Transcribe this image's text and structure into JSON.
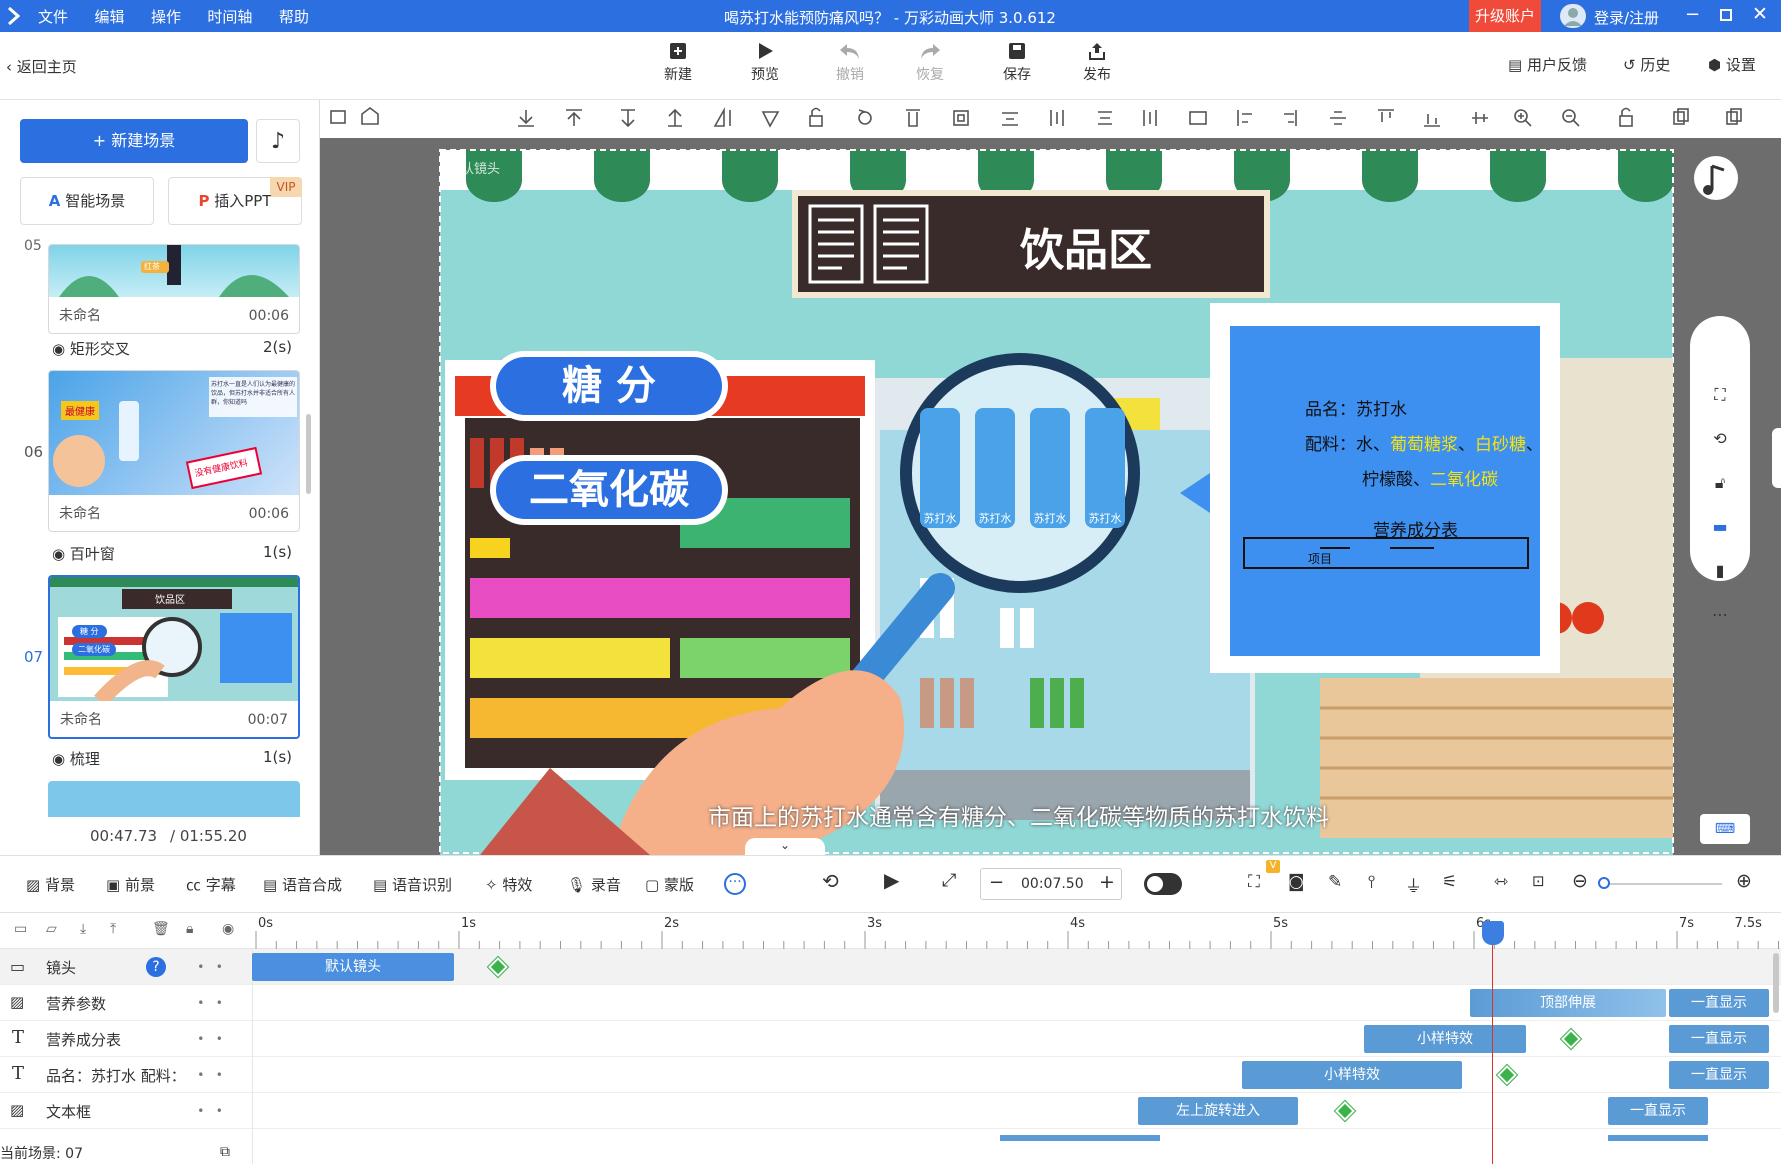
{
  "titlebar": {
    "menu": [
      "文件",
      "编辑",
      "操作",
      "时间轴",
      "帮助"
    ],
    "title": "喝苏打水能预防痛风吗？ - 万彩动画大师 3.0.612",
    "upgrade": "升级账户",
    "login": "登录/注册"
  },
  "toolbar": {
    "back": "返回主页",
    "buttons": [
      {
        "label": "新建",
        "icon": "plus-box-icon"
      },
      {
        "label": "预览",
        "icon": "play-icon"
      },
      {
        "label": "撤销",
        "icon": "undo-icon"
      },
      {
        "label": "恢复",
        "icon": "redo-icon"
      },
      {
        "label": "保存",
        "icon": "save-icon"
      },
      {
        "label": "发布",
        "icon": "publish-icon"
      }
    ],
    "right": [
      "用户反馈",
      "历史",
      "设置"
    ]
  },
  "left_panel": {
    "new_scene": "+ 新建场景",
    "smart_scene": "智能场景",
    "insert_ppt": "插入PPT",
    "vip": "VIP",
    "scenes": [
      {
        "num": "05",
        "name": "未命名",
        "time": "00:06"
      },
      {
        "num": "06",
        "name": "未命名",
        "time": "00:06"
      },
      {
        "num": "07",
        "name": "未命名",
        "time": "00:07"
      }
    ],
    "transitions": [
      {
        "name": "矩形交叉",
        "dur": "2(s)"
      },
      {
        "name": "百叶窗",
        "dur": "1(s)"
      },
      {
        "name": "梳理",
        "dur": "1(s)"
      }
    ],
    "time_current": "00:47.73",
    "time_total": "/ 01:55.20"
  },
  "canvas": {
    "camera_label": "默认镜头",
    "sign": "饮品区",
    "bubble1": "糖  分",
    "bubble2": "二氧化碳",
    "bottle_label": "苏打水",
    "info_name": "品名：苏打水",
    "info_ing_prefix": "配料：水、",
    "info_ing_1": "葡萄糖浆",
    "info_ing_sep1": "、",
    "info_ing_2": "白砂糖",
    "info_ing_sep2": "、",
    "info_ing_3": "柠檬酸",
    "info_ing_sep3": "、",
    "info_ing_4": "二氧化碳",
    "nutrition_title": "营养成分表",
    "nutrition_col": "项目",
    "subtitle": "市面上的苏打水通常含有糖分、二氧化碳等物质的苏打水饮料",
    "thumb_scene6_a": "最健康",
    "thumb_scene6_b": "没有健康饮料",
    "thumb_scene7_sign": "饮品区",
    "thumb_scene7_b1": "糖  分",
    "thumb_scene7_b2": "二氧化碳",
    "thumb_scene6_note": "苏打水一直是人们认为最健康的饮品，但苏打水并非适合所有人群，你知道吗",
    "thumb_scene5_tag": "红茶"
  },
  "controls": {
    "items": [
      "背景",
      "前景",
      "字幕",
      "语音合成",
      "语音识别",
      "特效",
      "录音",
      "蒙版"
    ],
    "time": "00:07.50",
    "vip": "V"
  },
  "timeline": {
    "ticks": [
      "0s",
      "1s",
      "2s",
      "3s",
      "4s",
      "5s",
      "6s",
      "7s",
      "7.5s"
    ],
    "tracks": [
      {
        "name": "镜头",
        "icon": "camera-icon"
      },
      {
        "name": "营养参数",
        "icon": "image-icon"
      },
      {
        "name": "营养成分表",
        "icon": "text-icon"
      },
      {
        "name": "品名：苏打水 配料：",
        "icon": "text-icon"
      },
      {
        "name": "文本框",
        "icon": "image-icon"
      }
    ],
    "bars": {
      "camera": "默认镜头",
      "r1a": "顶部伸展",
      "r1b": "一直显示",
      "r2a": "小样特效",
      "r2b": "一直显示",
      "r3a": "小样特效",
      "r3b": "一直显示",
      "r4a": "左上旋转进入",
      "r4b": "一直显示"
    },
    "help": "?",
    "current_scene": "当前场景: 07"
  }
}
